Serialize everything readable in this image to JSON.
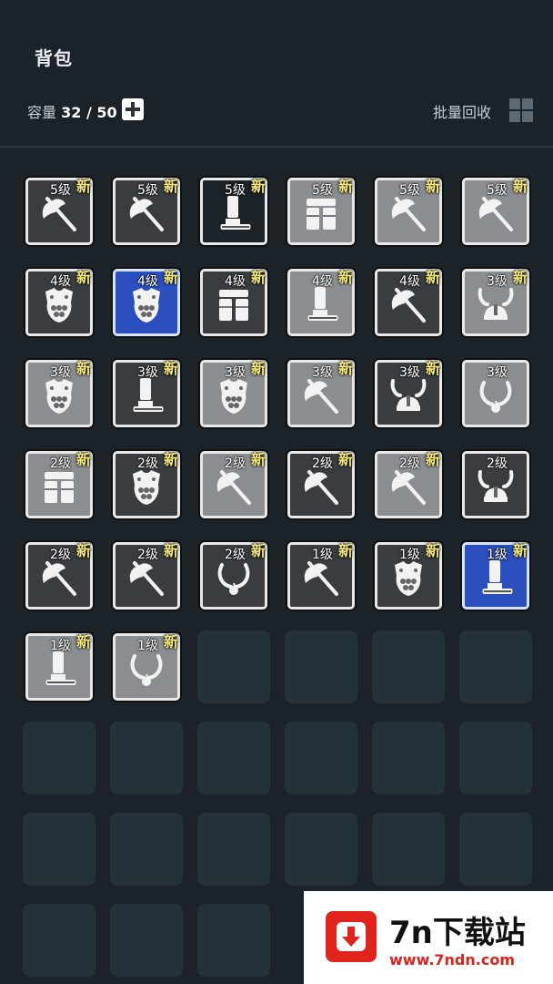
{
  "header": {
    "title": "背包",
    "capacity_label": "容量",
    "capacity_value": "32 / 50",
    "recycle_label": "批量回收"
  },
  "colors": {
    "background": "#1b2228",
    "new_tag": "#f4e87a",
    "blue_rarity": "#2b4fbd",
    "orange_rarity": "#d8742a"
  },
  "inventory": {
    "items": [
      {
        "level": "5级",
        "new": "新",
        "icon": "axe-icon",
        "rarity": "gray"
      },
      {
        "level": "5级",
        "new": "新",
        "icon": "axe-icon",
        "rarity": "gray"
      },
      {
        "level": "5级",
        "new": "新",
        "icon": "boot-icon",
        "rarity": "orange"
      },
      {
        "level": "5级",
        "new": "新",
        "icon": "pants-icon",
        "rarity": "dim"
      },
      {
        "level": "5级",
        "new": "新",
        "icon": "axe-icon",
        "rarity": "dim"
      },
      {
        "level": "5级",
        "new": "新",
        "icon": "axe-icon",
        "rarity": "dim"
      },
      {
        "level": "4级",
        "new": "新",
        "icon": "armor-icon",
        "rarity": "gray"
      },
      {
        "level": "4级",
        "new": "新",
        "icon": "armor-icon",
        "rarity": "blue"
      },
      {
        "level": "4级",
        "new": "新",
        "icon": "pants-icon",
        "rarity": "gray"
      },
      {
        "level": "4级",
        "new": "新",
        "icon": "boot-icon",
        "rarity": "dim"
      },
      {
        "level": "4级",
        "new": "新",
        "icon": "axe-icon",
        "rarity": "gray"
      },
      {
        "level": "3级",
        "new": "新",
        "icon": "helmet-icon",
        "rarity": "dim"
      },
      {
        "level": "3级",
        "new": "新",
        "icon": "armor-icon",
        "rarity": "dim"
      },
      {
        "level": "3级",
        "new": "新",
        "icon": "boot-icon",
        "rarity": "gray"
      },
      {
        "level": "3级",
        "new": "新",
        "icon": "armor-icon",
        "rarity": "dim"
      },
      {
        "level": "3级",
        "new": "新",
        "icon": "axe-icon",
        "rarity": "dim"
      },
      {
        "level": "3级",
        "new": "新",
        "icon": "helmet-icon",
        "rarity": "gray"
      },
      {
        "level": "3级",
        "new": "",
        "icon": "necklace-icon",
        "rarity": "dim"
      },
      {
        "level": "2级",
        "new": "新",
        "icon": "pants-icon",
        "rarity": "dim"
      },
      {
        "level": "2级",
        "new": "新",
        "icon": "armor-icon",
        "rarity": "gray"
      },
      {
        "level": "2级",
        "new": "新",
        "icon": "axe-icon",
        "rarity": "dim"
      },
      {
        "level": "2级",
        "new": "新",
        "icon": "axe-icon",
        "rarity": "gray"
      },
      {
        "level": "2级",
        "new": "新",
        "icon": "axe-icon",
        "rarity": "dim"
      },
      {
        "level": "2级",
        "new": "",
        "icon": "helmet-icon",
        "rarity": "gray"
      },
      {
        "level": "2级",
        "new": "新",
        "icon": "axe-icon",
        "rarity": "gray"
      },
      {
        "level": "2级",
        "new": "新",
        "icon": "axe-icon",
        "rarity": "gray"
      },
      {
        "level": "2级",
        "new": "新",
        "icon": "necklace-icon",
        "rarity": "gray"
      },
      {
        "level": "1级",
        "new": "新",
        "icon": "axe-icon",
        "rarity": "gray"
      },
      {
        "level": "1级",
        "new": "新",
        "icon": "armor-icon",
        "rarity": "gray"
      },
      {
        "level": "1级",
        "new": "新",
        "icon": "boot-icon",
        "rarity": "blue"
      },
      {
        "level": "1级",
        "new": "新",
        "icon": "boot-icon",
        "rarity": "dim"
      },
      {
        "level": "1级",
        "new": "新",
        "icon": "necklace-icon",
        "rarity": "dim"
      }
    ]
  },
  "watermark": {
    "name": "7n下载站",
    "url": "www.7ndn.com"
  }
}
